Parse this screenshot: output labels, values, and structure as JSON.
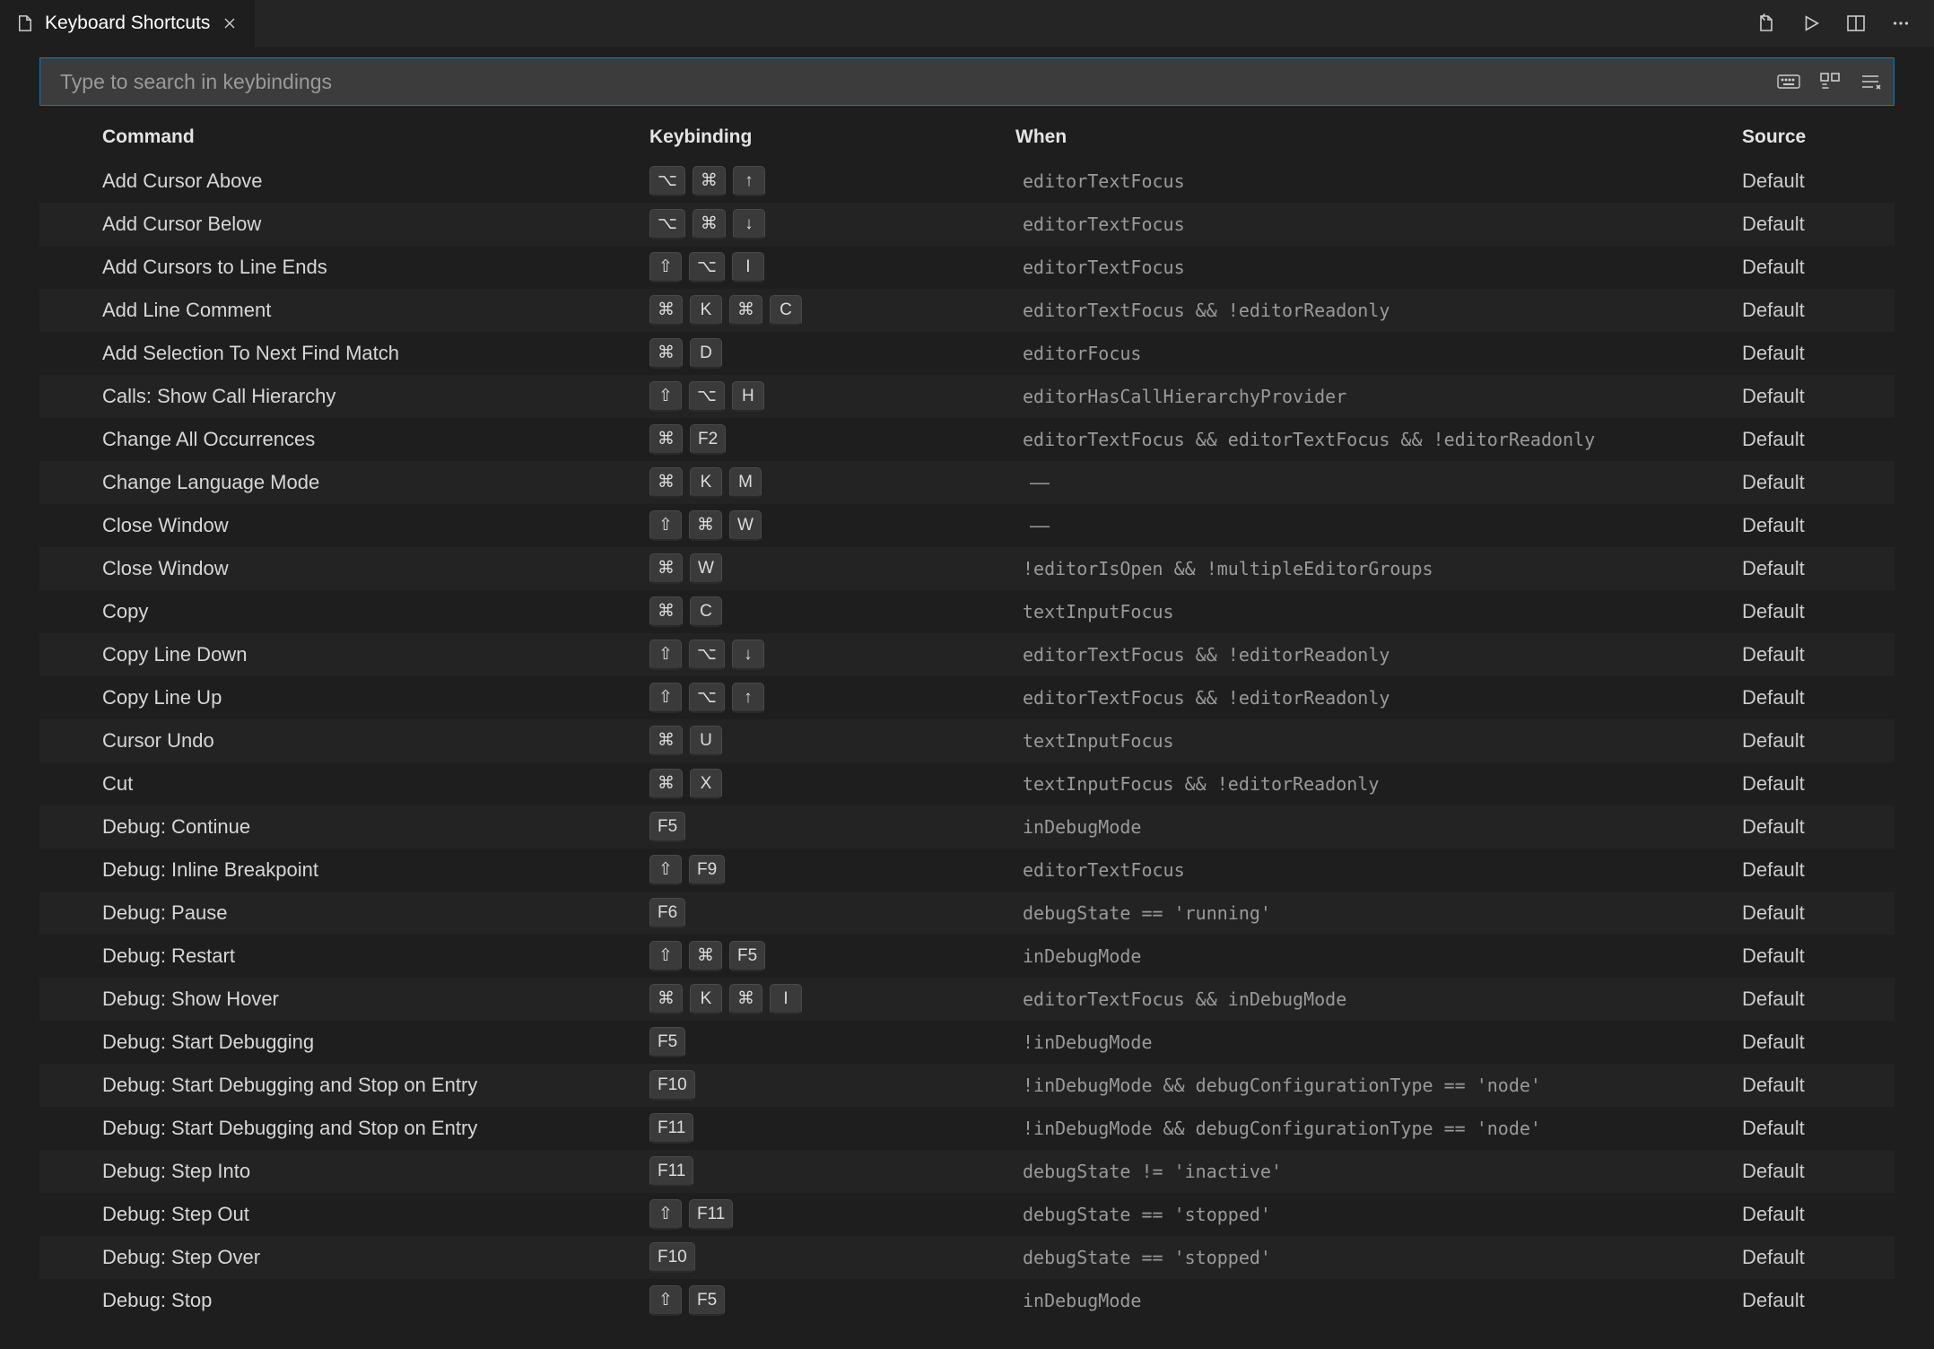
{
  "tab": {
    "title": "Keyboard Shortcuts"
  },
  "search": {
    "placeholder": "Type to search in keybindings"
  },
  "headers": {
    "command": "Command",
    "keybinding": "Keybinding",
    "when": "When",
    "source": "Source"
  },
  "rows": [
    {
      "command": "Add Cursor Above",
      "keys": [
        "⌥",
        "⌘",
        "↑"
      ],
      "when": "editorTextFocus",
      "source": "Default"
    },
    {
      "command": "Add Cursor Below",
      "keys": [
        "⌥",
        "⌘",
        "↓"
      ],
      "when": "editorTextFocus",
      "source": "Default"
    },
    {
      "command": "Add Cursors to Line Ends",
      "keys": [
        "⇧",
        "⌥",
        "I"
      ],
      "when": "editorTextFocus",
      "source": "Default"
    },
    {
      "command": "Add Line Comment",
      "keys": [
        "⌘",
        "K",
        "⌘",
        "C"
      ],
      "when": "editorTextFocus && !editorReadonly",
      "source": "Default"
    },
    {
      "command": "Add Selection To Next Find Match",
      "keys": [
        "⌘",
        "D"
      ],
      "when": "editorFocus",
      "source": "Default"
    },
    {
      "command": "Calls: Show Call Hierarchy",
      "keys": [
        "⇧",
        "⌥",
        "H"
      ],
      "when": "editorHasCallHierarchyProvider",
      "source": "Default"
    },
    {
      "command": "Change All Occurrences",
      "keys": [
        "⌘",
        "F2"
      ],
      "when": "editorTextFocus && editorTextFocus && !editorReadonly",
      "source": "Default"
    },
    {
      "command": "Change Language Mode",
      "keys": [
        "⌘",
        "K",
        "M"
      ],
      "when": "—",
      "source": "Default"
    },
    {
      "command": "Close Window",
      "keys": [
        "⇧",
        "⌘",
        "W"
      ],
      "when": "—",
      "source": "Default"
    },
    {
      "command": "Close Window",
      "keys": [
        "⌘",
        "W"
      ],
      "when": "!editorIsOpen && !multipleEditorGroups",
      "source": "Default"
    },
    {
      "command": "Copy",
      "keys": [
        "⌘",
        "C"
      ],
      "when": "textInputFocus",
      "source": "Default"
    },
    {
      "command": "Copy Line Down",
      "keys": [
        "⇧",
        "⌥",
        "↓"
      ],
      "when": "editorTextFocus && !editorReadonly",
      "source": "Default"
    },
    {
      "command": "Copy Line Up",
      "keys": [
        "⇧",
        "⌥",
        "↑"
      ],
      "when": "editorTextFocus && !editorReadonly",
      "source": "Default"
    },
    {
      "command": "Cursor Undo",
      "keys": [
        "⌘",
        "U"
      ],
      "when": "textInputFocus",
      "source": "Default"
    },
    {
      "command": "Cut",
      "keys": [
        "⌘",
        "X"
      ],
      "when": "textInputFocus && !editorReadonly",
      "source": "Default"
    },
    {
      "command": "Debug: Continue",
      "keys": [
        "F5"
      ],
      "when": "inDebugMode",
      "source": "Default"
    },
    {
      "command": "Debug: Inline Breakpoint",
      "keys": [
        "⇧",
        "F9"
      ],
      "when": "editorTextFocus",
      "source": "Default"
    },
    {
      "command": "Debug: Pause",
      "keys": [
        "F6"
      ],
      "when": "debugState == 'running'",
      "source": "Default"
    },
    {
      "command": "Debug: Restart",
      "keys": [
        "⇧",
        "⌘",
        "F5"
      ],
      "when": "inDebugMode",
      "source": "Default"
    },
    {
      "command": "Debug: Show Hover",
      "keys": [
        "⌘",
        "K",
        "⌘",
        "I"
      ],
      "when": "editorTextFocus && inDebugMode",
      "source": "Default"
    },
    {
      "command": "Debug: Start Debugging",
      "keys": [
        "F5"
      ],
      "when": "!inDebugMode",
      "source": "Default"
    },
    {
      "command": "Debug: Start Debugging and Stop on Entry",
      "keys": [
        "F10"
      ],
      "when": "!inDebugMode && debugConfigurationType == 'node'",
      "source": "Default"
    },
    {
      "command": "Debug: Start Debugging and Stop on Entry",
      "keys": [
        "F11"
      ],
      "when": "!inDebugMode && debugConfigurationType == 'node'",
      "source": "Default"
    },
    {
      "command": "Debug: Step Into",
      "keys": [
        "F11"
      ],
      "when": "debugState != 'inactive'",
      "source": "Default"
    },
    {
      "command": "Debug: Step Out",
      "keys": [
        "⇧",
        "F11"
      ],
      "when": "debugState == 'stopped'",
      "source": "Default"
    },
    {
      "command": "Debug: Step Over",
      "keys": [
        "F10"
      ],
      "when": "debugState == 'stopped'",
      "source": "Default"
    },
    {
      "command": "Debug: Stop",
      "keys": [
        "⇧",
        "F5"
      ],
      "when": "inDebugMode",
      "source": "Default"
    }
  ]
}
